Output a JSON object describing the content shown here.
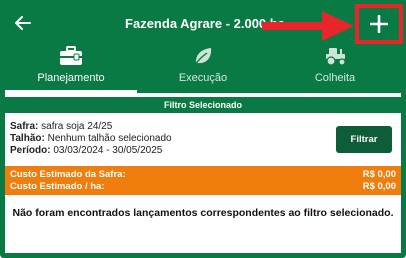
{
  "header": {
    "title": "Fazenda Agrare - 2.000 ha",
    "back_icon": "arrow-left-icon",
    "add_icon": "plus-icon",
    "annotation_color": "#e8262a",
    "brand_color": "#0a7a45"
  },
  "tabs": [
    {
      "label": "Planejamento",
      "icon": "toolbox-icon",
      "active": true
    },
    {
      "label": "Execução",
      "icon": "leaf-icon",
      "active": false
    },
    {
      "label": "Colheita",
      "icon": "tractor-icon",
      "active": false
    }
  ],
  "filter": {
    "banner": "Filtro Selecionado",
    "safra_label": "Safra:",
    "safra_value": " safra soja 24/25",
    "talhao_label": "Talhão:",
    "talhao_value": " Nenhum talhão selecionado",
    "periodo_label": "Período:",
    "periodo_value": " 03/03/2024 - 30/05/2025",
    "button_label": "Filtrar"
  },
  "costs": {
    "safra_label": "Custo Estimado da Safra:",
    "safra_value": "R$ 0,00",
    "ha_label": "Custo Estimado / ha:",
    "ha_value": "R$ 0,00",
    "color": "#f07e0f"
  },
  "empty_message": "Não foram encontrados lançamentos correspondentes ao filtro selecionado."
}
